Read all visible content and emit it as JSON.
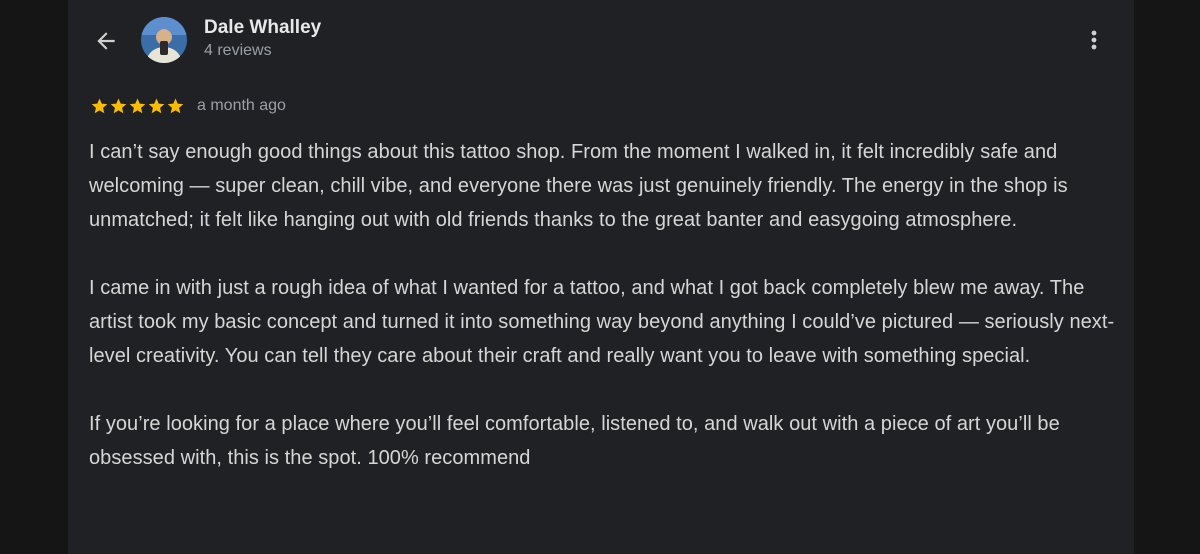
{
  "header": {
    "back_icon": "arrow-left-icon",
    "more_icon": "more-vertical-icon"
  },
  "author": {
    "name": "Dale Whalley",
    "review_count": "4 reviews"
  },
  "review": {
    "rating": 5,
    "rating_max": 5,
    "star_color": "#fbbc04",
    "date": "a month ago",
    "paragraphs": [
      "I can’t say enough good things about this tattoo shop. From the moment I walked in, it felt incredibly safe and welcoming — super clean, chill vibe, and everyone there was just genuinely friendly. The energy in the shop is unmatched; it felt like hanging out with old friends thanks to the great banter and easygoing atmosphere.",
      "I came in with just a rough idea of what I wanted for a tattoo, and what I got back completely blew me away. The artist took my basic concept and turned it into something way beyond anything I could’ve pictured — seriously next-level creativity. You can tell they care about their craft and really want you to leave with something special.",
      "If you’re looking for a place where you’ll feel comfortable, listened to, and walk out with a piece of art you’ll be obsessed with, this is the spot. 100% recommend"
    ]
  }
}
